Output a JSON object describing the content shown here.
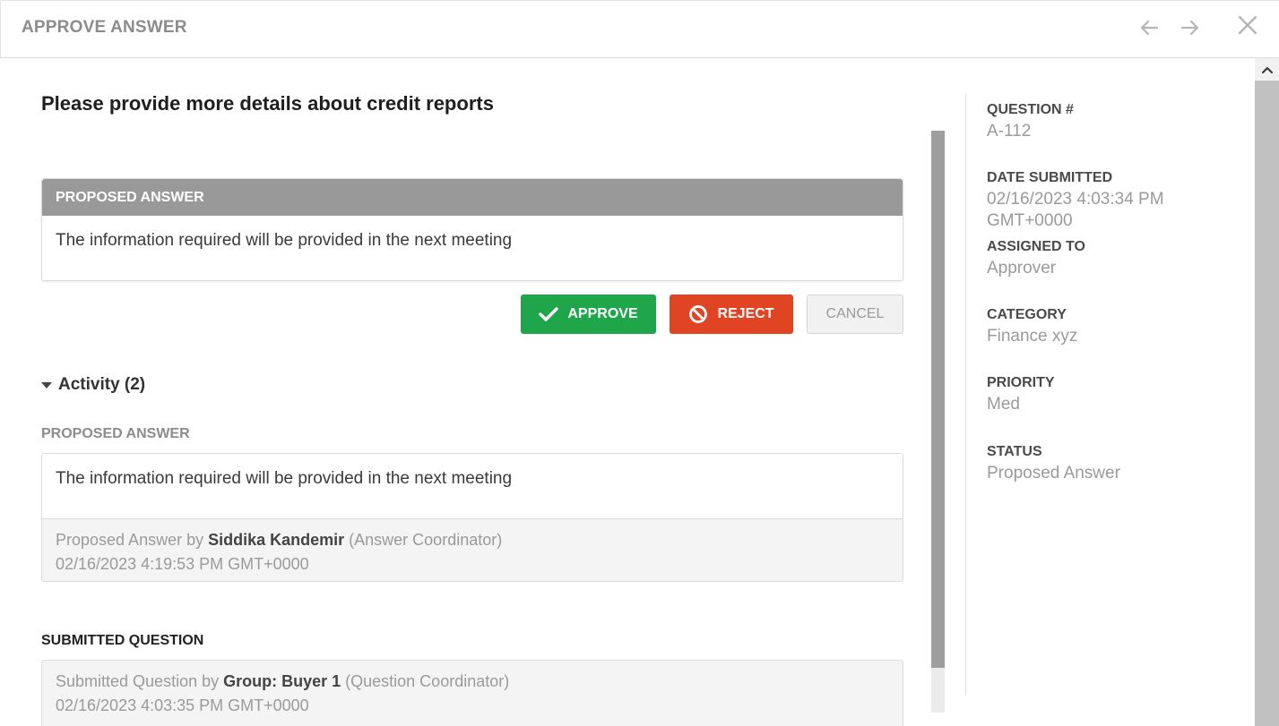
{
  "header": {
    "title": "APPROVE ANSWER"
  },
  "main": {
    "question_title": "Please provide more details about credit reports",
    "proposed_panel": {
      "header": "PROPOSED ANSWER",
      "text": "The information required will be provided in the next meeting"
    },
    "buttons": {
      "approve": "APPROVE",
      "reject": "REJECT",
      "cancel": "CANCEL"
    },
    "activity": {
      "label": "Activity (2)",
      "items": [
        {
          "section_label": "PROPOSED ANSWER",
          "text": "The information required will be provided in the next meeting",
          "prefix": "Proposed Answer by ",
          "author": "Siddika Kandemir",
          "role": " (Answer Coordinator)",
          "timestamp": "02/16/2023 4:19:53 PM GMT+0000"
        },
        {
          "section_label": "SUBMITTED QUESTION",
          "prefix": "Submitted Question by ",
          "author": "Group: Buyer 1",
          "role": " (Question Coordinator)",
          "timestamp": "02/16/2023 4:03:35 PM GMT+0000"
        }
      ]
    }
  },
  "sidebar": {
    "question_number_label": "QUESTION #",
    "question_number": "A-112",
    "date_submitted_label": "DATE SUBMITTED",
    "date_submitted": "02/16/2023 4:03:34 PM GMT+0000",
    "assigned_to_label": "ASSIGNED TO",
    "assigned_to": "Approver",
    "category_label": "CATEGORY",
    "category": "Finance xyz",
    "priority_label": "PRIORITY",
    "priority": "Med",
    "status_label": "STATUS",
    "status": "Proposed Answer"
  },
  "colors": {
    "approve": "#1fa64a",
    "reject": "#e04423",
    "panel_header": "#999999"
  },
  "icons": [
    "arrow-left-icon",
    "arrow-right-icon",
    "close-icon",
    "checkmark-icon",
    "prohibited-icon",
    "caret-down-icon",
    "scroll-up-icon"
  ]
}
